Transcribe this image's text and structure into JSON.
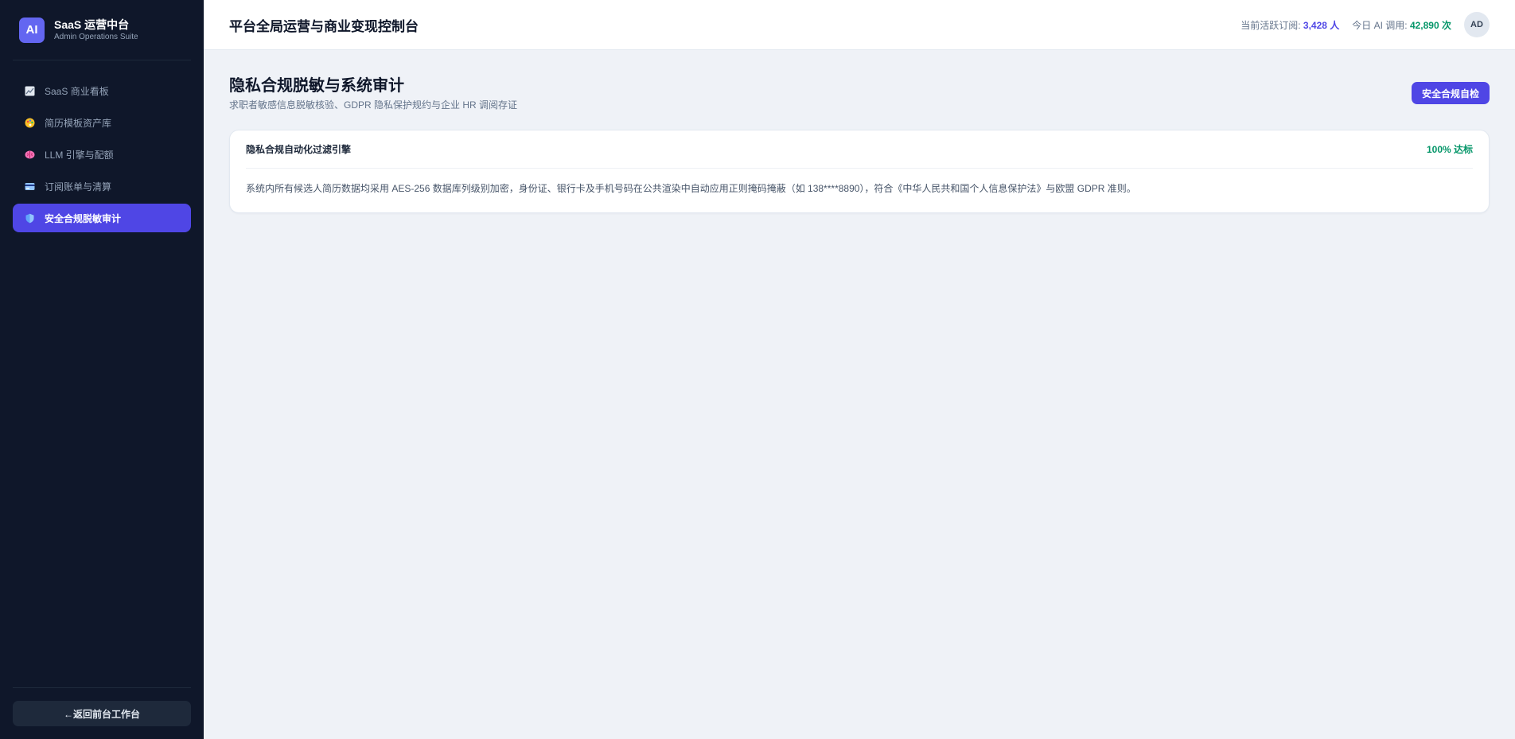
{
  "brand": {
    "logo_text": "AI",
    "title": "SaaS 运营中台",
    "subtitle": "Admin Operations Suite"
  },
  "sidebar": {
    "items": [
      {
        "label": "SaaS 商业看板",
        "icon": "chart-icon",
        "active": false
      },
      {
        "label": "简历模板资产库",
        "icon": "palette-icon",
        "active": false
      },
      {
        "label": "LLM 引擎与配额",
        "icon": "brain-icon",
        "active": false
      },
      {
        "label": "订阅账单与清算",
        "icon": "credit-card-icon",
        "active": false
      },
      {
        "label": "安全合规脱敏审计",
        "icon": "shield-icon",
        "active": true
      }
    ],
    "back_label": "←返回前台工作台"
  },
  "topbar": {
    "title": "平台全局运营与商业变现控制台",
    "active_subs_label": "当前活跃订阅:",
    "active_subs_value": "3,428 人",
    "ai_calls_label": "今日 AI 调用:",
    "ai_calls_value": "42,890 次",
    "avatar_initials": "AD"
  },
  "page": {
    "title": "隐私合规脱敏与系统审计",
    "subtitle": "求职者敏感信息脱敏核验、GDPR 隐私保护规约与企业 HR 调阅存证",
    "action_label": "安全合规自检"
  },
  "card": {
    "title": "隐私合规自动化过滤引擎",
    "badge": "100% 达标",
    "body": "系统内所有候选人简历数据均采用 AES-256 数据库列级别加密，身份证、银行卡及手机号码在公共渲染中自动应用正则掩码掩蔽（如 138****8890），符合《中华人民共和国个人信息保护法》与欧盟 GDPR 准则。"
  },
  "colors": {
    "sidebar_bg": "#0f172a",
    "accent": "#4f46e5",
    "success": "#059669",
    "page_bg": "#eff2f7"
  }
}
